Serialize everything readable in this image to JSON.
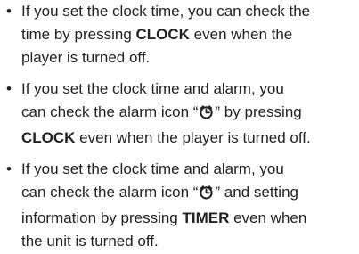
{
  "bullets": [
    {
      "marker": "•",
      "lines": [
        {
          "pre": "If you set the clock time, you can check the"
        },
        {
          "pre": "time by pressing ",
          "bold": "CLOCK",
          "post": " even when the"
        },
        {
          "pre": "player is turned off."
        }
      ]
    },
    {
      "marker": "•",
      "lines": [
        {
          "pre": "If you set the clock time and alarm, you"
        },
        {
          "pre": "can check the alarm icon “",
          "icon": "alarm-icon",
          "post": "” by pressing"
        },
        {
          "bold": "CLOCK",
          "post": " even when the player is turned off."
        }
      ]
    },
    {
      "marker": "•",
      "lines": [
        {
          "pre": "If you set the clock time and alarm, you"
        },
        {
          "pre": "can check the alarm icon “",
          "icon": "alarm-icon",
          "post": "” and setting"
        },
        {
          "pre": "information by pressing ",
          "bold": "TIMER",
          "post": " even when"
        },
        {
          "pre": "the unit is turned off."
        }
      ]
    }
  ]
}
